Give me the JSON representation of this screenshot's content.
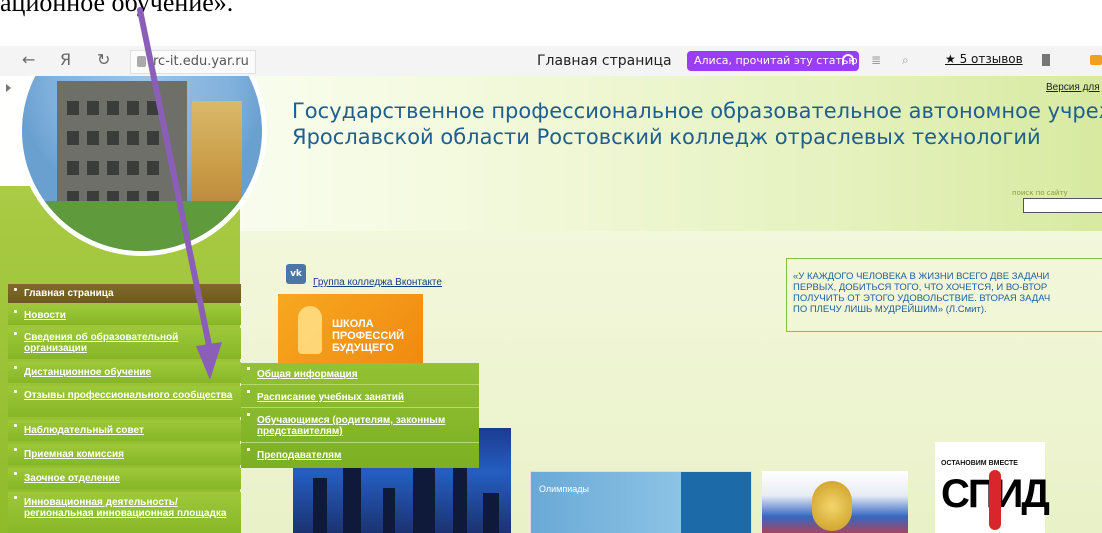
{
  "caption": {
    "text": "ационное обучение»."
  },
  "browser": {
    "back": "←",
    "yandex": "Я",
    "reload": "↻",
    "url": "rc-it.edu.yar.ru",
    "page_title": "Главная страница",
    "alice_button": "Алиса, прочитай эту статью",
    "reviews_link": "★ 5 отзывов"
  },
  "site": {
    "version_link": "Версия для",
    "title_line1": "Государственное профессиональное образовательное автономное учреждение",
    "title_line2": "Ярославской области Ростовский колледж отраслевых технологий",
    "search_label": "поиск по сайту",
    "search_value": "",
    "vk_link": "Группа колледжа Вконтакте",
    "school_banner": {
      "line1": "ШКОЛА",
      "line2": "ПРОФЕССИЙ",
      "line3": "БУДУЩЕГО"
    },
    "quote": {
      "line1": "«У КАЖДОГО ЧЕЛОВЕКА В ЖИЗНИ ВСЕГО ДВЕ ЗАДАЧИ",
      "line2": "ПЕРВЫХ, ДОБИТЬСЯ ТОГО,  ЧТО ХОЧЕТСЯ, И ВО-ВТОР",
      "line3": "ПОЛУЧИТЬ ОТ ЭТОГО УДОВОЛЬСТВИЕ. ВТОРАЯ ЗАДАЧ",
      "line4": "ПО ПЛЕЧУ ЛИШЬ МУДРЕЙШИМ»  (Л.Смит)."
    },
    "olymp_label": "Олимпиады",
    "spid": {
      "small": "ОСТАНОВИМ  ВМЕСТЕ",
      "big": "СПИД"
    }
  },
  "menu": {
    "items": [
      {
        "label": "Главная страница"
      },
      {
        "label": "Новости"
      },
      {
        "label": "Сведения об образовательной организации"
      },
      {
        "label": "Дистанционное обучение"
      },
      {
        "label": "Отзывы профессионального сообщества"
      },
      {
        "label": "Наблюдательный совет"
      },
      {
        "label": "Приемная комиссия"
      },
      {
        "label": "Заочное отделение"
      },
      {
        "label": "Инновационная деятельность/ региональная инновационная площадка"
      }
    ]
  },
  "submenu": {
    "items": [
      {
        "label": "Общая информация"
      },
      {
        "label": "Расписание учебных занятий"
      },
      {
        "label": "Обучающимся (родителям, законным представителям)"
      },
      {
        "label": "Преподавателям"
      }
    ]
  },
  "colors": {
    "accent": "#8b5fb8",
    "menu_green": "#8fbb2a",
    "title_blue": "#1f5f8f",
    "alice_purple": "#9b3df2"
  }
}
